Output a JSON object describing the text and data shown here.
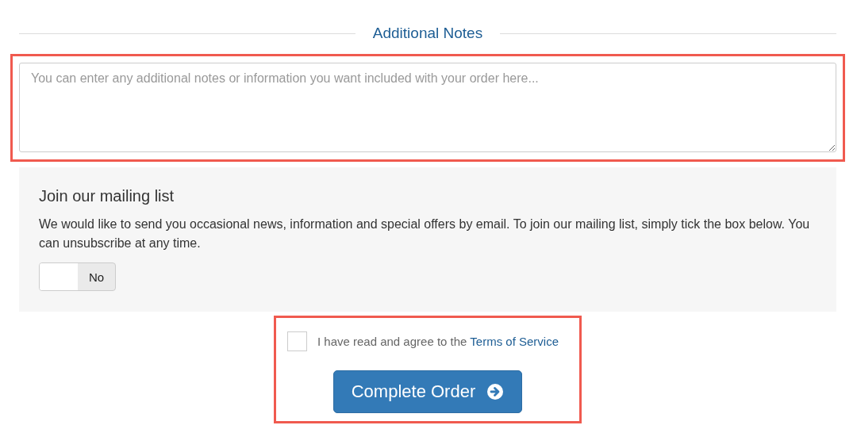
{
  "notes": {
    "heading": "Additional Notes",
    "placeholder": "You can enter any additional notes or information you want included with your order here..."
  },
  "mailing_list": {
    "title": "Join our mailing list",
    "description": "We would like to send you occasional news, information and special offers by email. To join our mailing list, simply tick the box below. You can unsubscribe at any time.",
    "toggle": {
      "on": false,
      "label": "No"
    }
  },
  "terms": {
    "checked": false,
    "text": "I have read and agree to the ",
    "link": "Terms of Service"
  },
  "submit": {
    "label": "Complete Order"
  }
}
